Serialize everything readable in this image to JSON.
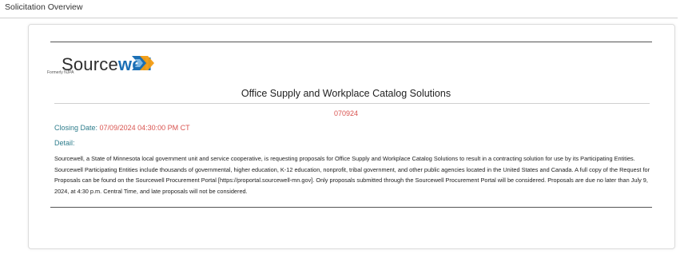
{
  "section": {
    "title": "Solicitation Overview"
  },
  "logo": {
    "text_plain": "Source",
    "text_bold": "well",
    "subtitle": "Formerly NJPA"
  },
  "document": {
    "title": "Office Supply and Workplace Catalog Solutions",
    "number": "070924",
    "closing_label": "Closing Date:",
    "closing_value": "07/09/2024 04:30:00 PM CT",
    "detail_label": "Detail:",
    "detail_text": "Sourcewell, a State of Minnesota local government unit and service cooperative, is requesting proposals for Office Supply and Workplace Catalog Solutions to result in a contracting solution for use by its Participating Entities. Sourcewell Participating Entities include thousands of governmental, higher education, K-12 education, nonprofit, tribal government, and other public agencies located in the United States and Canada. A full copy of the Request for Proposals can be found on the Sourcewell Procurement Portal [https://proportal.sourcewell-mn.gov]. Only proposals submitted through the Sourcewell Procurement Portal will be considered. Proposals are due no later than July 9, 2024, at 4:30 p.m. Central Time, and late proposals will not be considered."
  },
  "colors": {
    "accent_red": "#d9534f",
    "label_teal": "#2e7d8c",
    "logo_blue": "#1b6fb5",
    "logo_orange": "#f39c12"
  },
  "icons": {
    "logo_mark": "sourcewell-arrow-icon"
  }
}
